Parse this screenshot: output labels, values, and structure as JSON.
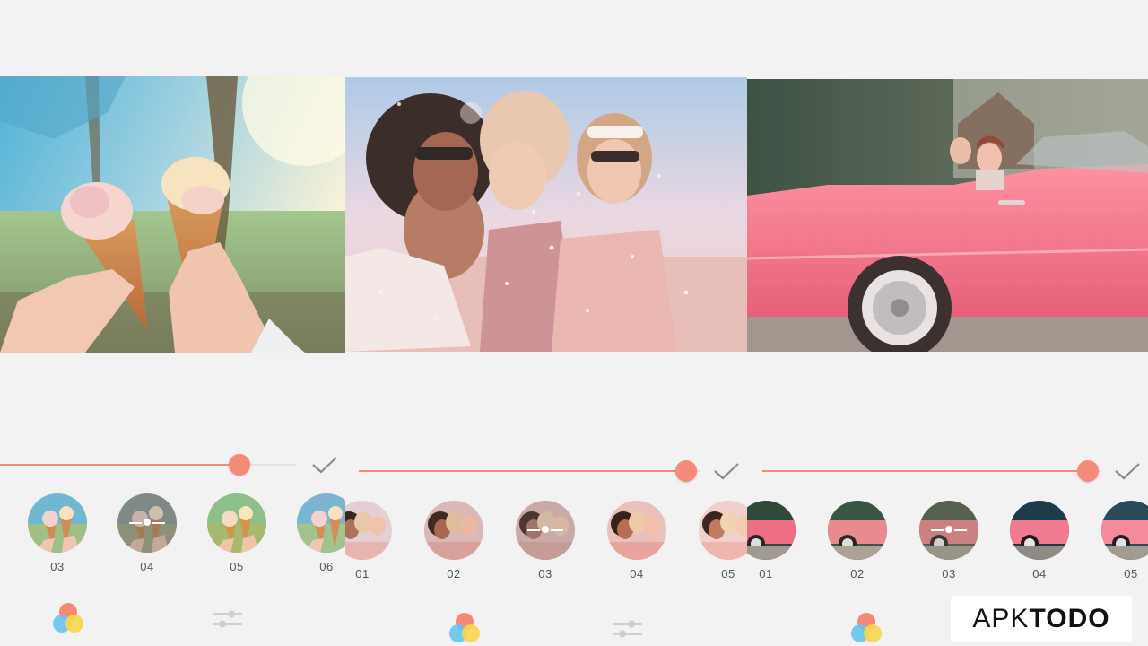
{
  "panels": [
    {
      "photo": "ice-cream-cones",
      "slider": {
        "value": 0.81
      },
      "filters": [
        {
          "label": "03",
          "selected": false
        },
        {
          "label": "04",
          "selected": true
        },
        {
          "label": "05",
          "selected": false
        },
        {
          "label": "06",
          "selected": false
        }
      ]
    },
    {
      "photo": "friends-blowing-glitter",
      "slider": {
        "value": 0.96
      },
      "filters": [
        {
          "label": "01",
          "selected": false
        },
        {
          "label": "02",
          "selected": false
        },
        {
          "label": "03",
          "selected": true
        },
        {
          "label": "04",
          "selected": false
        },
        {
          "label": "05",
          "selected": false
        }
      ]
    },
    {
      "photo": "pink-convertible-car",
      "slider": {
        "value": 0.96
      },
      "filters": [
        {
          "label": "01",
          "selected": false
        },
        {
          "label": "02",
          "selected": false
        },
        {
          "label": "03",
          "selected": true
        },
        {
          "label": "04",
          "selected": false
        },
        {
          "label": "05",
          "selected": false
        }
      ]
    }
  ],
  "toolbar": {
    "filters_icon": "three-circles-icon",
    "adjust_icon": "sliders-icon",
    "confirm_icon": "check-icon"
  },
  "watermark": {
    "prefix": "APK",
    "suffix": "TODO"
  },
  "colors": {
    "accent": "#f58a78",
    "background": "#f2f2f2",
    "icon_red": "#f6836e",
    "icon_yellow": "#f9d64a",
    "icon_blue": "#69c3f0"
  }
}
